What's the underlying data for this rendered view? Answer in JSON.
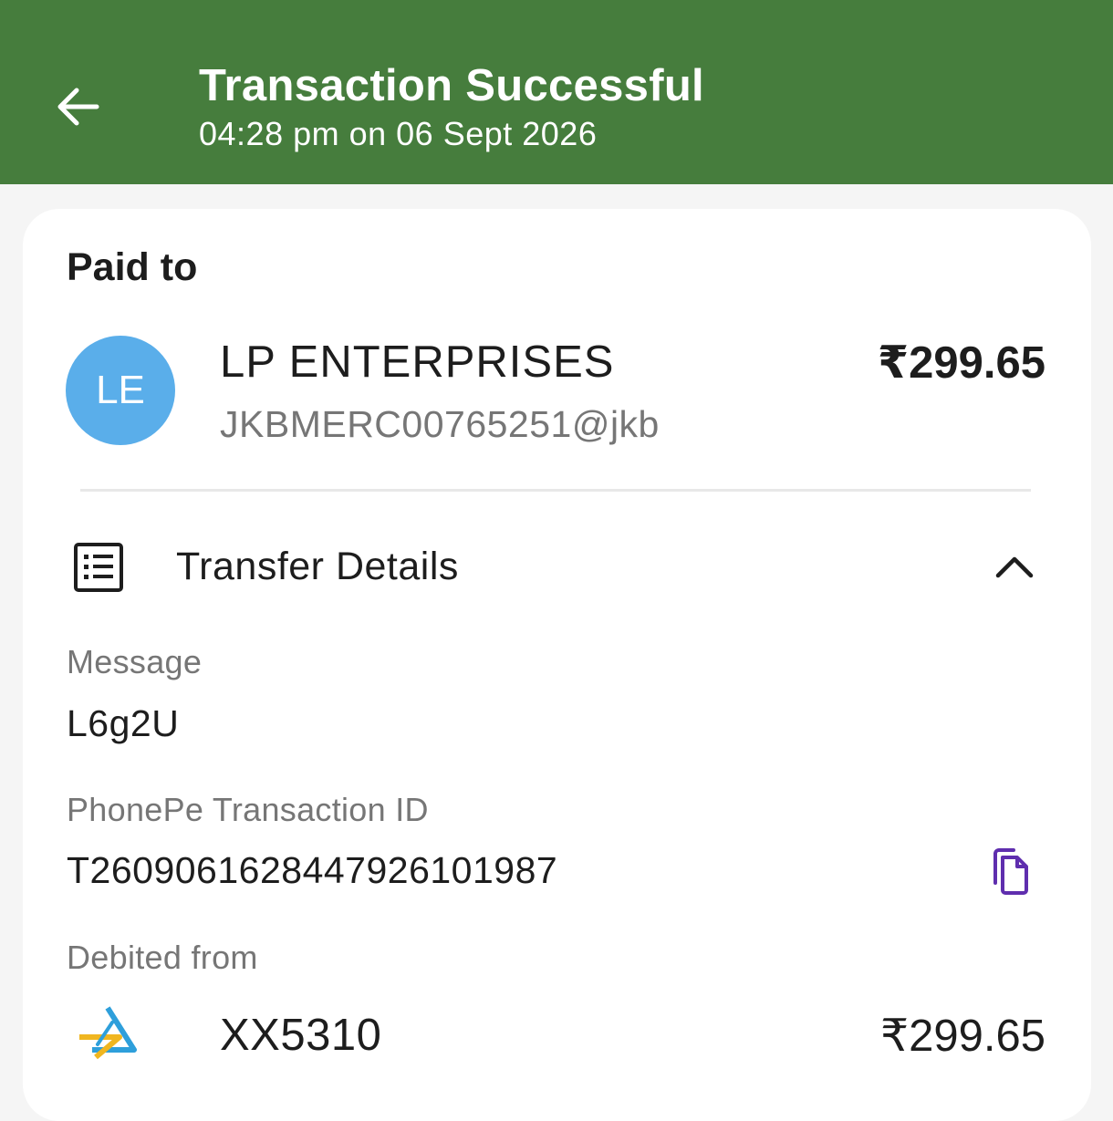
{
  "header": {
    "title": "Transaction Successful",
    "subtitle": "04:28 pm on 06 Sept 2026",
    "background_color": "#467d3d",
    "back_icon": "arrow-left-icon"
  },
  "paid_to": {
    "label": "Paid to",
    "avatar_initials": "LE",
    "avatar_color": "#5aaeea",
    "name": "LP ENTERPRISES",
    "vpa": "JKBMERC00765251@jkb",
    "amount": "₹299.65"
  },
  "transfer_details": {
    "title": "Transfer Details",
    "icon": "receipt-list-icon",
    "toggle_icon": "chevron-up-icon",
    "message_label": "Message",
    "message_value": "L6g2U",
    "txn_id_label": "PhonePe Transaction ID",
    "txn_id_value": "T2609061628447926101987",
    "copy_icon": "copy-icon",
    "copy_icon_color": "#5f2eae",
    "debited_label": "Debited from",
    "bank_icon": "bank-logo-icon",
    "account": "XX5310",
    "debited_amount": "₹299.65"
  }
}
